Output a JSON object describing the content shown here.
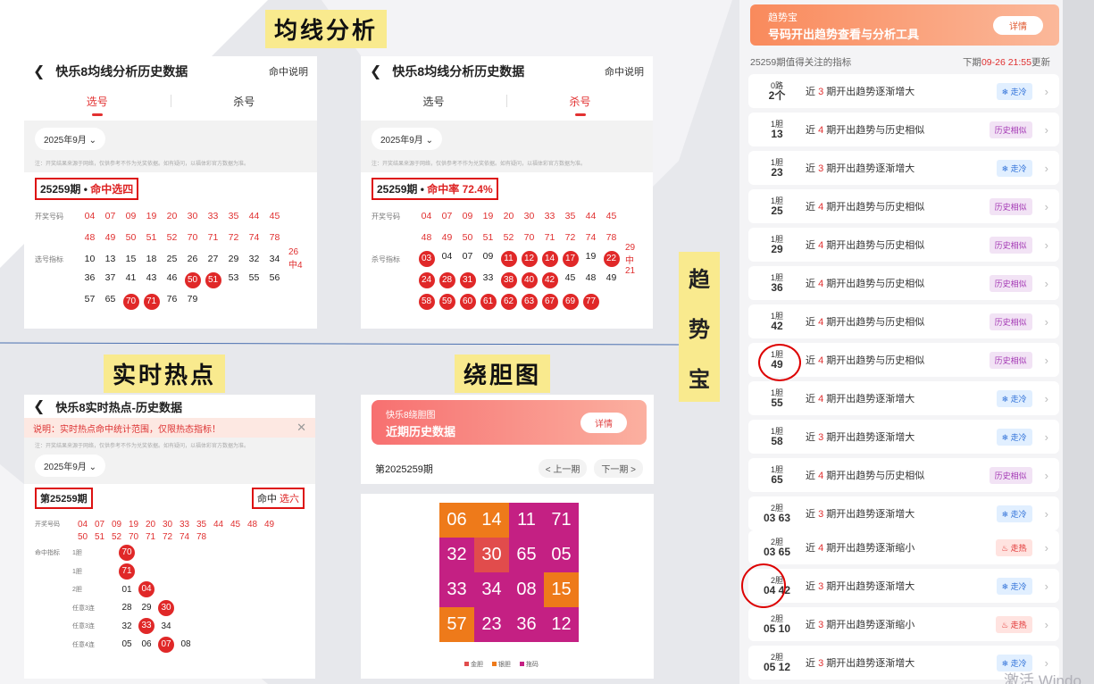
{
  "sections": {
    "avg_title": "均线分析",
    "hot_title": "实时热点",
    "dan_title": "绕胆图",
    "trend_title_chars": [
      "趋",
      "势",
      "宝"
    ]
  },
  "avg_pick": {
    "header": "快乐8均线分析历史数据",
    "help": "命中说明",
    "tabs": [
      "选号",
      "杀号"
    ],
    "month": "2025年9月",
    "note": "注：开奖结果来源于网络，仅供参考不作为兑奖依据。如有疑问，以福体彩官方数据为准。",
    "period": "25259期 •",
    "hit": "命中选四",
    "draw_label": "开奖号码",
    "index_label": "选号指标",
    "draw_row1": [
      "04",
      "07",
      "09",
      "19",
      "20",
      "30",
      "33",
      "35",
      "44",
      "45"
    ],
    "draw_row2": [
      "48",
      "49",
      "50",
      "51",
      "52",
      "70",
      "71",
      "72",
      "74",
      "78"
    ],
    "idx_row1": [
      "10",
      "13",
      "15",
      "18",
      "25",
      "26",
      "27",
      "29",
      "32",
      "34"
    ],
    "idx_row1_count": "26中4",
    "idx_row2": [
      "36",
      "37",
      "41",
      "43",
      "46",
      "50",
      "51",
      "53",
      "55",
      "56"
    ],
    "idx_row3": [
      "57",
      "65",
      "70",
      "71",
      "76",
      "79"
    ]
  },
  "avg_kill": {
    "header": "快乐8均线分析历史数据",
    "help": "命中说明",
    "tabs": [
      "选号",
      "杀号"
    ],
    "month": "2025年9月",
    "note": "注：开奖结果来源于网络，仅供参考不作为兑奖依据。如有疑问，以福体彩官方数据为准。",
    "period": "25259期 •",
    "hit": "命中率 72.4%",
    "draw_label": "开奖号码",
    "index_label": "杀号指标",
    "draw_row1": [
      "04",
      "07",
      "09",
      "19",
      "20",
      "30",
      "33",
      "35",
      "44",
      "45"
    ],
    "draw_row2": [
      "48",
      "49",
      "50",
      "51",
      "52",
      "70",
      "71",
      "72",
      "74",
      "78"
    ],
    "idx_row1": [
      "03",
      "04",
      "07",
      "09",
      "11",
      "12",
      "14",
      "17",
      "19",
      "22"
    ],
    "idx_row1_count": "29中21",
    "idx_row2": [
      "24",
      "28",
      "31",
      "33",
      "38",
      "40",
      "42",
      "45",
      "48",
      "49"
    ],
    "idx_row3": [
      "58",
      "59",
      "60",
      "61",
      "62",
      "63",
      "67",
      "69",
      "77"
    ]
  },
  "hot": {
    "header": "快乐8实时热点-历史数据",
    "notice": "说明：实时热点命中统计范围，仅限热态指标！",
    "note": "注：开奖结果来源于网络，仅供参考不作为兑奖依据。如有疑问，以福体彩官方数据为准。",
    "month": "2025年9月",
    "period": "第25259期",
    "hit_label": "命中",
    "hit_value": "选六",
    "draw_label": "开奖号码",
    "draw_row1": [
      "04",
      "07",
      "09",
      "19",
      "20",
      "30",
      "33",
      "35",
      "44",
      "45",
      "48",
      "49"
    ],
    "draw_row2": [
      "50",
      "51",
      "52",
      "70",
      "71",
      "72",
      "74",
      "78"
    ],
    "idx_label": "命中指标",
    "rows": [
      {
        "label": "1胆",
        "nums": [
          "70"
        ]
      },
      {
        "label": "1胆",
        "nums": [
          "71"
        ]
      },
      {
        "label": "2胆",
        "nums": [
          "01",
          "04"
        ]
      },
      {
        "label": "任意3连",
        "nums": [
          "28",
          "29",
          "30"
        ]
      },
      {
        "label": "任意3连",
        "nums": [
          "32",
          "33",
          "34"
        ]
      },
      {
        "label": "任意4连",
        "nums": [
          "05",
          "06",
          "07",
          "08"
        ]
      }
    ]
  },
  "dan": {
    "banner_small": "快乐8绕胆图",
    "banner_big": "近期历史数据",
    "details": "详情",
    "period": "第2025259期",
    "prev": "< 上一期",
    "next": "下一期 >",
    "grid": [
      "06",
      "14",
      "11",
      "71",
      "32",
      "30",
      "65",
      "05",
      "33",
      "34",
      "08",
      "15",
      "57",
      "23",
      "36",
      "12"
    ],
    "legend": [
      "金胆",
      "银胆",
      "拖码"
    ]
  },
  "trend": {
    "banner_small": "趋势宝",
    "banner_big": "号码开出趋势查看与分析工具",
    "details": "详情",
    "sub_left": "25259期值得关注的指标",
    "sub_right_prefix": "下期",
    "sub_right_time": "09-26 21:55",
    "sub_right_suffix": "更新",
    "items": [
      {
        "a": "0路",
        "b": "2个",
        "pre": "近",
        "n": "3",
        "post": "期开出趋势逐渐增大",
        "badge": "走冷",
        "type": "cold"
      },
      {
        "a": "1胆",
        "b": "13",
        "pre": "近",
        "n": "4",
        "post": "期开出趋势与历史相似",
        "badge": "历史相似",
        "type": "sim"
      },
      {
        "a": "1胆",
        "b": "23",
        "pre": "近",
        "n": "3",
        "post": "期开出趋势逐渐增大",
        "badge": "走冷",
        "type": "cold"
      },
      {
        "a": "1胆",
        "b": "25",
        "pre": "近",
        "n": "4",
        "post": "期开出趋势与历史相似",
        "badge": "历史相似",
        "type": "sim"
      },
      {
        "a": "1胆",
        "b": "29",
        "pre": "近",
        "n": "4",
        "post": "期开出趋势与历史相似",
        "badge": "历史相似",
        "type": "sim"
      },
      {
        "a": "1胆",
        "b": "36",
        "pre": "近",
        "n": "4",
        "post": "期开出趋势与历史相似",
        "badge": "历史相似",
        "type": "sim"
      },
      {
        "a": "1胆",
        "b": "42",
        "pre": "近",
        "n": "4",
        "post": "期开出趋势与历史相似",
        "badge": "历史相似",
        "type": "sim"
      },
      {
        "a": "1胆",
        "b": "49",
        "pre": "近",
        "n": "4",
        "post": "期开出趋势与历史相似",
        "badge": "历史相似",
        "type": "sim"
      },
      {
        "a": "1胆",
        "b": "55",
        "pre": "近",
        "n": "4",
        "post": "期开出趋势逐渐增大",
        "badge": "走冷",
        "type": "cold"
      },
      {
        "a": "1胆",
        "b": "58",
        "pre": "近",
        "n": "3",
        "post": "期开出趋势逐渐增大",
        "badge": "走冷",
        "type": "cold"
      },
      {
        "a": "1胆",
        "b": "65",
        "pre": "近",
        "n": "4",
        "post": "期开出趋势与历史相似",
        "badge": "历史相似",
        "type": "sim"
      },
      {
        "a": "2胆",
        "b": "03 63",
        "pre": "近",
        "n": "3",
        "post": "期开出趋势逐渐增大",
        "badge": "走冷",
        "type": "cold"
      },
      {
        "a": "2胆",
        "b": "03 65",
        "pre": "近",
        "n": "4",
        "post": "期开出趋势逐渐缩小",
        "badge": "走热",
        "type": "hot"
      },
      {
        "a": "2胆",
        "b": "04 42",
        "pre": "近",
        "n": "3",
        "post": "期开出趋势逐渐增大",
        "badge": "走冷",
        "type": "cold"
      },
      {
        "a": "2胆",
        "b": "05 10",
        "pre": "近",
        "n": "3",
        "post": "期开出趋势逐渐缩小",
        "badge": "走热",
        "type": "hot"
      },
      {
        "a": "2胆",
        "b": "05 12",
        "pre": "近",
        "n": "3",
        "post": "期开出趋势逐渐增大",
        "badge": "走冷",
        "type": "cold"
      }
    ]
  },
  "watermark": "激活 Windo"
}
